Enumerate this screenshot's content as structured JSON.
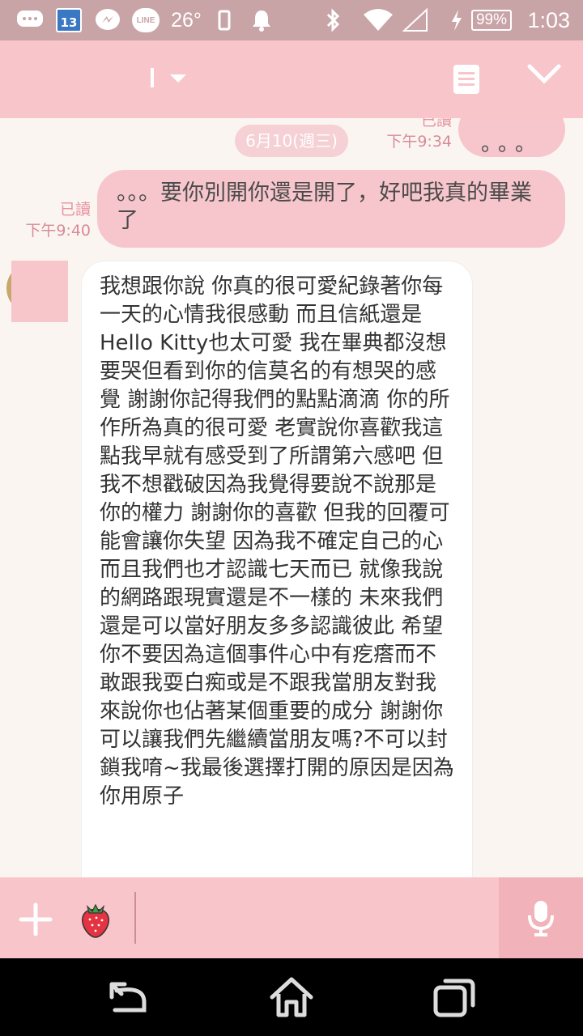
{
  "status_bar": {
    "calendar_day": "13",
    "line_badge": "LINE",
    "temperature": "26°",
    "battery": "99%",
    "time": "1:03"
  },
  "icons": {
    "back": "back-icon",
    "home": "home-icon",
    "recents": "recents-icon",
    "mic": "mic-icon",
    "add": "plus-icon",
    "sticker": "strawberry-icon",
    "notes": "notes-icon",
    "collapse": "chevron-down-icon"
  },
  "colors": {
    "header": "#f8c5cb",
    "status_bar": "#c9a4a6",
    "outgoing_bubble": "#f7c6cc",
    "incoming_bubble": "#ffffff",
    "chat_bg": "#fbf5f1"
  },
  "chat": {
    "date_separator": "6月10(週三)",
    "messages": [
      {
        "direction": "out",
        "text": "。。。",
        "read_label": "已讀",
        "time": "下午9:34"
      },
      {
        "direction": "out",
        "text": "。。。要你別開你還是開了，好吧我真的畢業了",
        "read_label": "已讀",
        "time": "下午9:40"
      },
      {
        "direction": "in",
        "text": "我想跟你說 你真的很可愛紀錄著你每一天的心情我很感動 而且信紙還是Hello Kitty也太可愛 我在畢典都沒想要哭但看到你的信莫名的有想哭的感覺 謝謝你記得我們的點點滴滴 你的所作所為真的很可愛 老實說你喜歡我這點我早就有感受到了所謂第六感吧 但我不想戳破因為我覺得要說不說那是你的權力 謝謝你的喜歡 但我的回覆可能會讓你失望 因為我不確定自己的心 而且我們也才認識七天而已 就像我說的網路跟現實還是不一樣的 未來我們還是可以當好朋友多多認識彼此 希望你不要因為這個事件心中有疙瘩而不敢跟我耍白痴或是不跟我當朋友對我來說你也佔著某個重要的成分 謝謝你  可以讓我們先繼續當朋友嗎?不可以封鎖我唷~我最後選擇打開的原因是因為你用原子"
      }
    ]
  },
  "input": {
    "value": ""
  }
}
